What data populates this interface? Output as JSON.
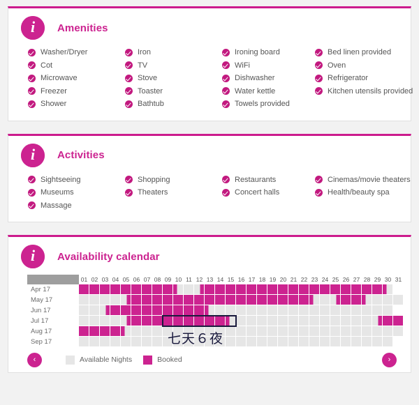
{
  "accent": "#cc2390",
  "panels": [
    {
      "id": "amenities",
      "title": "Amenities",
      "icon": "info-icon",
      "columns": [
        [
          "Washer/Dryer",
          "Cot",
          "Microwave",
          "Freezer",
          "Shower"
        ],
        [
          "Iron",
          "TV",
          "Stove",
          "Toaster",
          "Bathtub"
        ],
        [
          "Ironing board",
          "WiFi",
          "Dishwasher",
          "Water kettle",
          "Towels provided"
        ],
        [
          "Bed linen provided",
          "Oven",
          "Refrigerator",
          "Kitchen utensils provided"
        ]
      ]
    },
    {
      "id": "activities",
      "title": "Activities",
      "icon": "info-icon",
      "columns": [
        [
          "Sightseeing",
          "Museums",
          "Massage"
        ],
        [
          "Shopping",
          "Theaters"
        ],
        [
          "Restaurants",
          "Concert halls"
        ],
        [
          "Cinemas/movie theaters",
          "Health/beauty spa"
        ]
      ]
    }
  ],
  "calendar": {
    "title": "Availability calendar",
    "icon": "info-icon",
    "days": [
      "01",
      "02",
      "03",
      "04",
      "05",
      "06",
      "07",
      "08",
      "09",
      "10",
      "11",
      "12",
      "13",
      "14",
      "15",
      "16",
      "17",
      "18",
      "19",
      "20",
      "21",
      "22",
      "23",
      "24",
      "25",
      "26",
      "27",
      "28",
      "29",
      "30",
      "31"
    ],
    "months": [
      "Apr 17",
      "May 17",
      "Jun 17",
      "Jul 17",
      "Aug 17",
      "Sep 17"
    ],
    "legend": {
      "available_label": "Available Nights",
      "booked_label": "Booked",
      "available_color": "#e6e6e6",
      "booked_color": "#cc2390"
    },
    "prev_label": "‹",
    "next_label": "›",
    "annotation": "七天６夜",
    "selection": {
      "month": "Jul 17",
      "start_day": "09",
      "end_day": "15"
    },
    "cells": {
      "Apr 17": [
        "b",
        "b",
        "b",
        "b",
        "b",
        "b",
        "b",
        "b",
        "b",
        "he",
        "e",
        "hs",
        "b",
        "b",
        "b",
        "b",
        "b",
        "b",
        "b",
        "b",
        "b",
        "b",
        "b",
        "b",
        "b",
        "b",
        "b",
        "b",
        "b",
        "he",
        "x"
      ],
      "May 17": [
        "e",
        "e",
        "e",
        "e",
        "hs",
        "b",
        "b",
        "b",
        "b",
        "b",
        "b",
        "b",
        "b",
        "b",
        "b",
        "b",
        "b",
        "b",
        "b",
        "b",
        "b",
        "b",
        "he",
        "e",
        "hs",
        "b",
        "b",
        "he",
        "e",
        "e",
        "e"
      ],
      "Jun 17": [
        "e",
        "e",
        "hs",
        "b",
        "b",
        "b",
        "b",
        "b",
        "b",
        "b",
        "b",
        "b",
        "he",
        "e",
        "e",
        "e",
        "e",
        "e",
        "e",
        "e",
        "e",
        "e",
        "e",
        "e",
        "e",
        "e",
        "e",
        "e",
        "e",
        "e",
        "x"
      ],
      "Jul 17": [
        "e",
        "e",
        "e",
        "e",
        "hs",
        "b",
        "b",
        "b",
        "b",
        "b",
        "b",
        "b",
        "b",
        "b",
        "he",
        "e",
        "e",
        "e",
        "e",
        "e",
        "e",
        "e",
        "e",
        "e",
        "e",
        "e",
        "e",
        "e",
        "hs",
        "b",
        "b"
      ],
      "Aug 17": [
        "b",
        "b",
        "b",
        "b",
        "he",
        "e",
        "e",
        "e",
        "e",
        "e",
        "e",
        "e",
        "e",
        "e",
        "e",
        "e",
        "e",
        "e",
        "e",
        "e",
        "e",
        "e",
        "e",
        "e",
        "e",
        "e",
        "e",
        "e",
        "e",
        "e",
        "e"
      ],
      "Sep 17": [
        "e",
        "e",
        "e",
        "e",
        "e",
        "e",
        "e",
        "e",
        "e",
        "e",
        "e",
        "e",
        "e",
        "e",
        "e",
        "e",
        "e",
        "e",
        "e",
        "e",
        "e",
        "e",
        "e",
        "e",
        "e",
        "e",
        "e",
        "e",
        "e",
        "e",
        "x"
      ]
    }
  }
}
